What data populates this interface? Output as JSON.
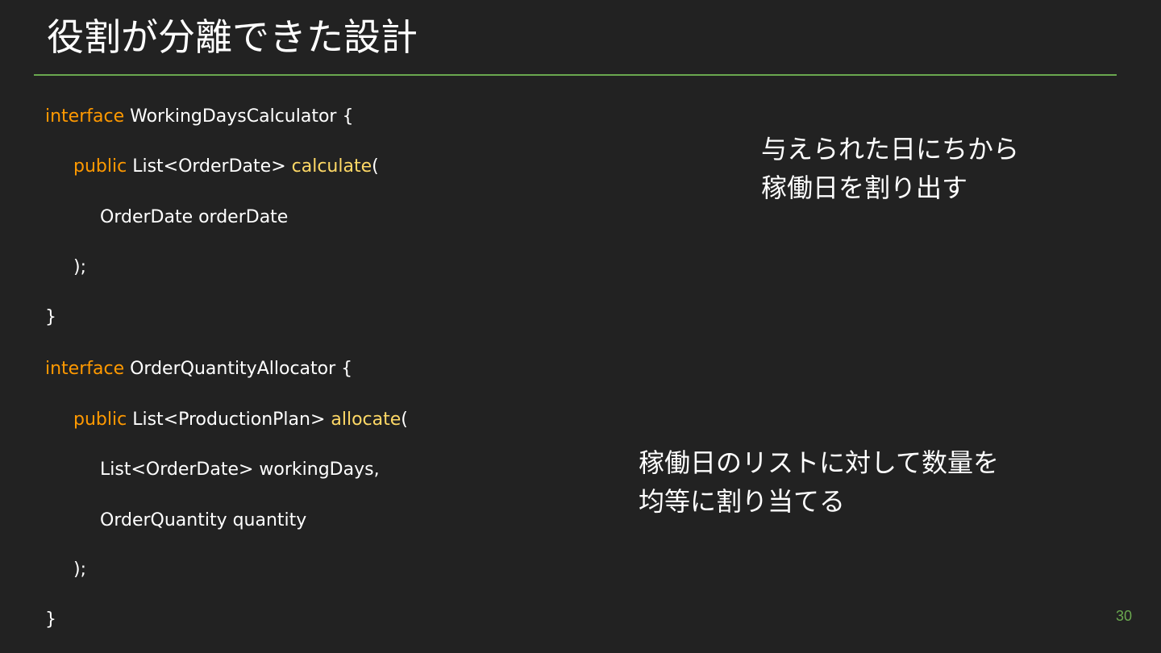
{
  "slide": {
    "title": "役割が分離できた設計",
    "page_number": "30"
  },
  "code": {
    "line1": {
      "keyword": "interface",
      "rest": " WorkingDaysCalculator {"
    },
    "line2": {
      "keyword": "public",
      "type": " List<OrderDate> ",
      "method": "calculate",
      "rest": "("
    },
    "line3": {
      "text": "OrderDate orderDate"
    },
    "line4": {
      "text": ");"
    },
    "line5": {
      "text": "}"
    },
    "line6": {
      "keyword": "interface",
      "rest": " OrderQuantityAllocator {"
    },
    "line7": {
      "keyword": "public",
      "type": " List<ProductionPlan> ",
      "method": "allocate",
      "rest": "("
    },
    "line8": {
      "text": "List<OrderDate> workingDays,"
    },
    "line9": {
      "text": "OrderQuantity quantity"
    },
    "line10": {
      "text": ");"
    },
    "line11": {
      "text": "}"
    }
  },
  "notes": {
    "note1": {
      "line1": "与えられた日にちから",
      "line2": "稼働日を割り出す"
    },
    "note2": {
      "line1": "稼働日のリストに対して数量を",
      "line2": "均等に割り当てる"
    }
  },
  "colors": {
    "background": "#222222",
    "accent_rule": "#6aa84f",
    "keyword": "#ff9900",
    "method": "#ffd966",
    "text": "#ffffff"
  }
}
